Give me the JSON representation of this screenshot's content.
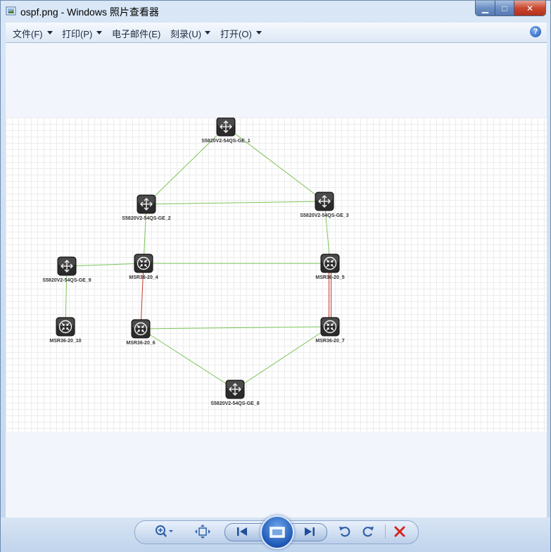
{
  "window": {
    "title": "ospf.png - Windows 照片查看器",
    "minimize_glyph": "▁",
    "maximize_glyph": "□",
    "close_glyph": "✕"
  },
  "menu": {
    "file": "文件(F)",
    "print": "打印(P)",
    "email": "电子邮件(E)",
    "burn": "刻录(U)",
    "open": "打开(O)",
    "help": "?"
  },
  "topology": {
    "nodes": [
      {
        "id": "n1",
        "label": "S5820V2-54QS-GE_1",
        "type": "switch"
      },
      {
        "id": "n2",
        "label": "S5820V2-54QS-GE_2",
        "type": "switch"
      },
      {
        "id": "n3",
        "label": "S5820V2-54QS-GE_3",
        "type": "switch"
      },
      {
        "id": "n4",
        "label": "MSR36-20_4",
        "type": "router"
      },
      {
        "id": "n5",
        "label": "MSR36-20_5",
        "type": "router"
      },
      {
        "id": "n6",
        "label": "MSR36-20_6",
        "type": "router"
      },
      {
        "id": "n7",
        "label": "MSR36-20_7",
        "type": "router"
      },
      {
        "id": "n8",
        "label": "S5820V2-54QS-GE_8",
        "type": "switch"
      },
      {
        "id": "n9",
        "label": "S5820V2-54QS-GE_9",
        "type": "switch"
      },
      {
        "id": "n10",
        "label": "MSR36-20_10",
        "type": "router"
      }
    ],
    "links": [
      {
        "from": "n1",
        "to": "n2",
        "color": "#7dc55a"
      },
      {
        "from": "n1",
        "to": "n3",
        "color": "#7dc55a"
      },
      {
        "from": "n2",
        "to": "n3",
        "color": "#7dc55a"
      },
      {
        "from": "n2",
        "to": "n4",
        "color": "#7dc55a"
      },
      {
        "from": "n3",
        "to": "n5",
        "color": "#7dc55a"
      },
      {
        "from": "n9",
        "to": "n4",
        "color": "#7dc55a"
      },
      {
        "from": "n4",
        "to": "n5",
        "color": "#7dc55a"
      },
      {
        "from": "n9",
        "to": "n10",
        "color": "#7dc55a"
      },
      {
        "from": "n4",
        "to": "n6",
        "color": "#c0392b"
      },
      {
        "from": "n5",
        "to": "n7",
        "color": "#c0392b",
        "double": true
      },
      {
        "from": "n6",
        "to": "n7",
        "color": "#7dc55a"
      },
      {
        "from": "n6",
        "to": "n8",
        "color": "#7dc55a"
      },
      {
        "from": "n7",
        "to": "n8",
        "color": "#7dc55a"
      }
    ]
  },
  "controls": {
    "zoom_icon": "zoom-icon",
    "fit_icon": "actual-size-icon",
    "prev_icon": "previous-icon",
    "slideshow_icon": "slideshow-icon",
    "next_icon": "next-icon",
    "rotate_ccw_icon": "rotate-left-icon",
    "rotate_cw_icon": "rotate-right-icon",
    "delete_icon": "delete-icon"
  }
}
